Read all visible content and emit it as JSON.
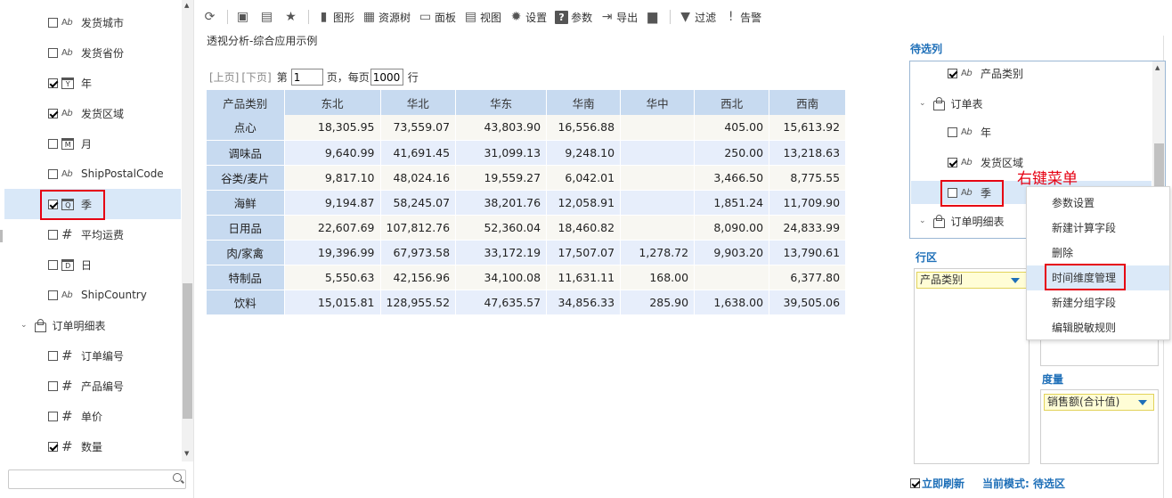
{
  "left_tree": {
    "items": [
      {
        "label": "发货城市",
        "checked": false,
        "type": "Ab"
      },
      {
        "label": "发货省份",
        "checked": false,
        "type": "Ab"
      },
      {
        "label": "年",
        "checked": true,
        "type": "Y"
      },
      {
        "label": "发货区域",
        "checked": true,
        "type": "Ab"
      },
      {
        "label": "月",
        "checked": false,
        "type": "M"
      },
      {
        "label": "ShipPostalCode",
        "checked": false,
        "type": "Ab"
      },
      {
        "label": "季",
        "checked": true,
        "type": "Q"
      },
      {
        "label": "平均运费",
        "checked": false,
        "type": "#"
      },
      {
        "label": "日",
        "checked": false,
        "type": "D"
      },
      {
        "label": "ShipCountry",
        "checked": false,
        "type": "Ab"
      }
    ],
    "group": "订单明细表",
    "group_items": [
      {
        "label": "订单编号",
        "checked": false,
        "type": "#"
      },
      {
        "label": "产品编号",
        "checked": false,
        "type": "#"
      },
      {
        "label": "单价",
        "checked": false,
        "type": "#"
      },
      {
        "label": "数量",
        "checked": true,
        "type": "#"
      }
    ],
    "search_placeholder": ""
  },
  "toolbar": {
    "items": [
      {
        "icon": "refresh-icon",
        "label": ""
      },
      {
        "icon": "save-icon",
        "label": ""
      },
      {
        "icon": "save-as-icon",
        "label": ""
      },
      {
        "icon": "star-icon",
        "label": ""
      },
      {
        "icon": "chart-icon",
        "label": "图形"
      },
      {
        "icon": "resource-tree-icon",
        "label": "资源树"
      },
      {
        "icon": "panel-icon",
        "label": "面板"
      },
      {
        "icon": "view-icon",
        "label": "视图"
      },
      {
        "icon": "gear-icon",
        "label": "设置"
      },
      {
        "icon": "question-icon",
        "label": "参数"
      },
      {
        "icon": "export-icon",
        "label": "导出"
      },
      {
        "icon": "print-icon",
        "label": ""
      },
      {
        "icon": "filter-icon",
        "label": "过滤"
      },
      {
        "icon": "alert-icon",
        "label": "告警"
      }
    ]
  },
  "subtitle": "透视分析-综合应用示例",
  "pager": {
    "prev": "[上页]",
    "next": "[下页]",
    "page_prefix": "第",
    "page_value": "1",
    "page_suffix": "页，每页",
    "per_page_value": "1000",
    "per_page_suffix": "行"
  },
  "table": {
    "headers": [
      "产品类别",
      "东北",
      "华北",
      "华东",
      "华南",
      "华中",
      "西北",
      "西南"
    ],
    "rows": [
      [
        "点心",
        "18,305.95",
        "73,559.07",
        "43,803.90",
        "16,556.88",
        "",
        "405.00",
        "15,613.92"
      ],
      [
        "调味品",
        "9,640.99",
        "41,691.45",
        "31,099.13",
        "9,248.10",
        "",
        "250.00",
        "13,218.63"
      ],
      [
        "谷类/麦片",
        "9,817.10",
        "48,024.16",
        "19,559.27",
        "6,042.01",
        "",
        "3,466.50",
        "8,775.55"
      ],
      [
        "海鲜",
        "9,194.87",
        "58,245.07",
        "38,201.76",
        "12,058.91",
        "",
        "1,851.24",
        "11,709.90"
      ],
      [
        "日用品",
        "22,607.69",
        "107,812.76",
        "52,360.04",
        "18,460.82",
        "",
        "8,090.00",
        "24,833.99"
      ],
      [
        "肉/家禽",
        "19,396.99",
        "67,973.58",
        "33,172.19",
        "17,507.07",
        "1,278.72",
        "9,903.20",
        "13,790.61"
      ],
      [
        "特制品",
        "5,550.63",
        "42,156.96",
        "34,100.08",
        "11,631.11",
        "168.00",
        "",
        "6,377.80"
      ],
      [
        "饮料",
        "15,015.81",
        "128,955.52",
        "47,635.57",
        "34,856.33",
        "285.90",
        "1,638.00",
        "39,505.06"
      ]
    ]
  },
  "right": {
    "pool_title": "待选列",
    "pool_items": [
      {
        "label": "产品类别",
        "checked": true,
        "type": "Ab"
      },
      {
        "label": "订单表",
        "kind": "group"
      },
      {
        "label": "年",
        "checked": false,
        "type": "Ab"
      },
      {
        "label": "发货区域",
        "checked": true,
        "type": "Ab"
      },
      {
        "label": "季",
        "checked": false,
        "type": "Ab"
      },
      {
        "label": "订单明细表",
        "kind": "group"
      }
    ],
    "row_zone_title": "行区",
    "row_zone_value": "产品类别",
    "measure_title": "度量",
    "measure_value": "销售额(合计值)",
    "refresh_label": "立即刷新",
    "refresh_checked": true,
    "mode_label": "当前模式: 待选区"
  },
  "context_menu": {
    "items": [
      "参数设置",
      "新建计算字段",
      "删除",
      "时间维度管理",
      "新建分组字段",
      "编辑脱敏规则"
    ],
    "highlighted_index": 3
  },
  "annotation": "右键菜单"
}
